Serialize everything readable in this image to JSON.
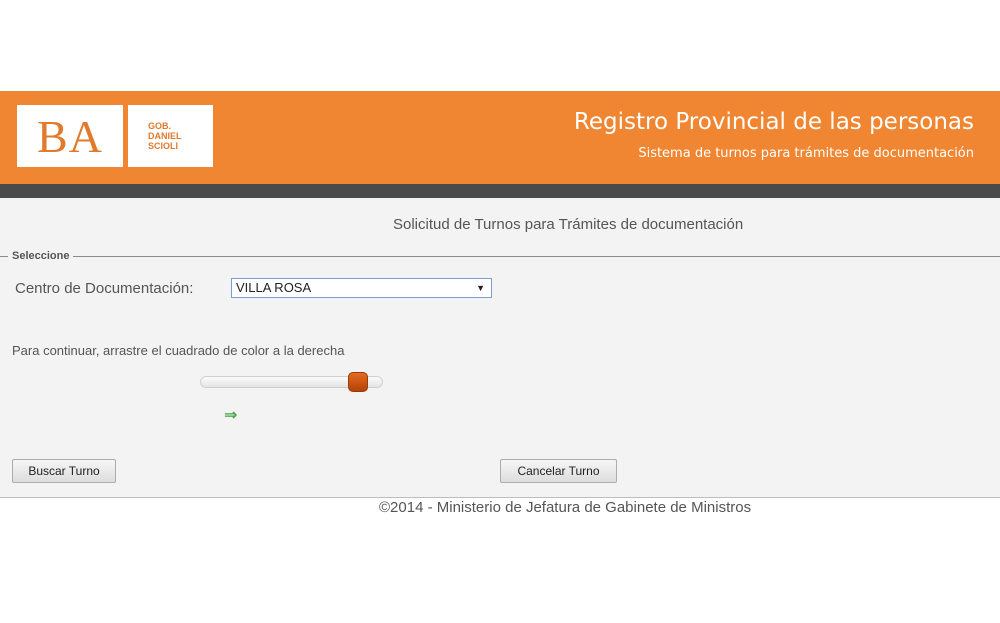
{
  "header": {
    "logo_ba": "BA",
    "logo_gob": "GOB. DANIEL SCIOLI",
    "title": "Registro Provincial de las personas",
    "subtitle": "Sistema de turnos para trámites de documentación"
  },
  "form": {
    "heading": "Solicitud de Turnos para Trámites de documentación",
    "legend": "Seleccione",
    "centro_label": "Centro de Documentación:",
    "centro_value": "VILLA ROSA",
    "instruction": "Para continuar, arrastre el cuadrado de color a la derecha",
    "slider_progress": 0.9,
    "buscar_label": "Buscar Turno",
    "cancelar_label": "Cancelar Turno"
  },
  "footer": {
    "text": "©2014 - Ministerio de Jefatura de Gabinete de Ministros"
  },
  "colors": {
    "header_orange": "#f08532",
    "header_stripe": "#4a4a4a",
    "slider_handle": "#c95312",
    "arrow_green": "#3ea53e"
  },
  "icons": {
    "select_arrow": "chevron-down-icon",
    "continue_arrow": "arrow-right-icon"
  }
}
